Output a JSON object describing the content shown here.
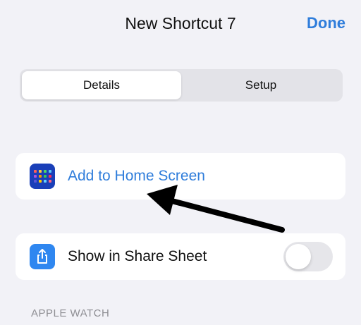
{
  "nav": {
    "title": "New Shortcut 7",
    "done_label": "Done"
  },
  "segments": [
    {
      "label": "Details",
      "selected": true
    },
    {
      "label": "Setup",
      "selected": false
    }
  ],
  "rows": {
    "add_home": {
      "label": "Add to Home Screen",
      "icon": "home-grid-icon"
    },
    "share_sheet": {
      "label": "Show in Share Sheet",
      "icon": "share-icon",
      "toggle_on": false
    }
  },
  "sections": {
    "apple_watch": "APPLE WATCH"
  },
  "colors": {
    "accent": "#2f7ddb",
    "background": "#f2f2f7",
    "share_icon_bg": "#2f87f0",
    "home_icon_bg": "#1a3fb8"
  }
}
